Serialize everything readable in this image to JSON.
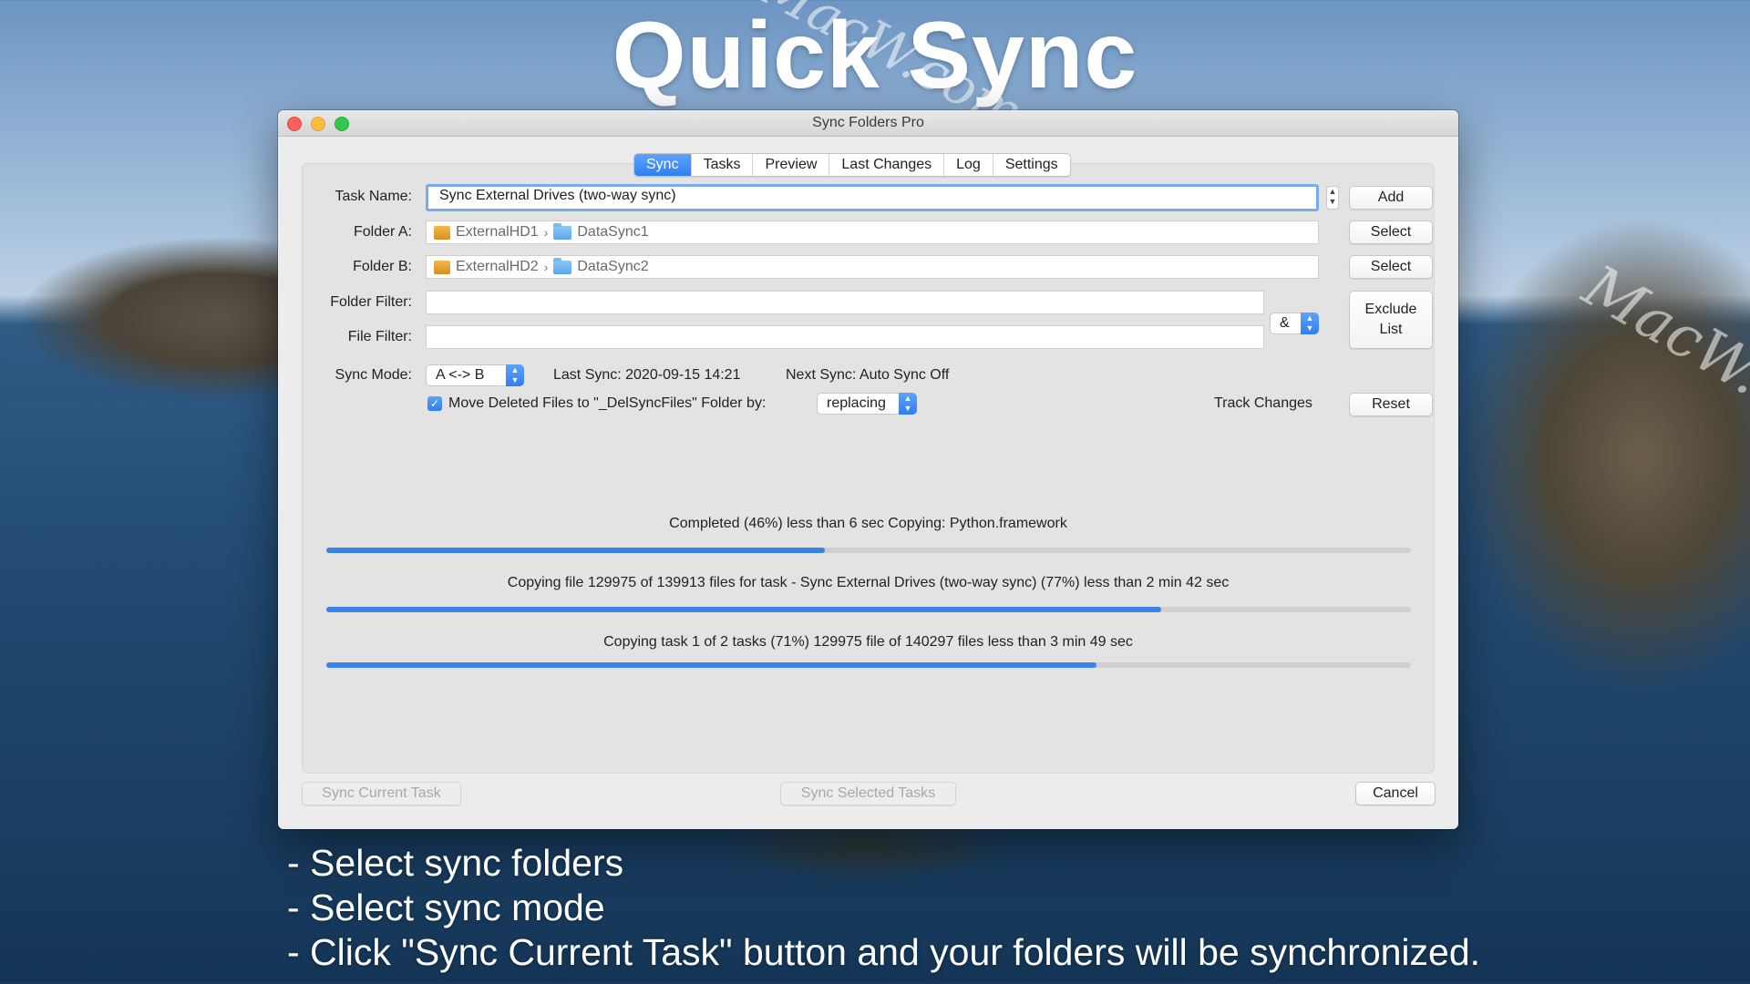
{
  "promo": {
    "title": "Quick Sync",
    "watermark": "MacW.com",
    "captions": [
      "- Select sync folders",
      "- Select sync mode",
      "- Click \"Sync Current Task\" button and your folders will be synchronized."
    ]
  },
  "window": {
    "title": "Sync Folders Pro"
  },
  "tabs": [
    {
      "label": "Sync",
      "active": true
    },
    {
      "label": "Tasks"
    },
    {
      "label": "Preview"
    },
    {
      "label": "Last Changes"
    },
    {
      "label": "Log"
    },
    {
      "label": "Settings"
    }
  ],
  "form": {
    "task_name_label": "Task Name:",
    "task_name_value": "Sync External Drives (two-way sync)",
    "folder_a_label": "Folder A:",
    "folder_a_drive": "ExternalHD1",
    "folder_a_folder": "DataSync1",
    "folder_b_label": "Folder B:",
    "folder_b_drive": "ExternalHD2",
    "folder_b_folder": "DataSync2",
    "folder_filter_label": "Folder Filter:",
    "file_filter_label": "File Filter:",
    "filter_operator": "&",
    "sync_mode_label": "Sync Mode:",
    "sync_mode_value": "A <-> B",
    "last_sync": "Last Sync: 2020-09-15 14:21",
    "next_sync": "Next Sync: Auto Sync Off",
    "move_deleted_label": "Move Deleted Files to \"_DelSyncFiles\" Folder by:",
    "move_deleted_checked": true,
    "move_deleted_mode": "replacing",
    "track_changes_label": "Track Changes"
  },
  "buttons": {
    "add": "Add",
    "select_a": "Select",
    "select_b": "Select",
    "exclude_list_line1": "Exclude",
    "exclude_list_line2": "List",
    "reset": "Reset",
    "sync_current": "Sync Current Task",
    "sync_selected": "Sync Selected Tasks",
    "cancel": "Cancel"
  },
  "progress": [
    {
      "label": "Completed (46%) less than 6 sec Copying: Python.framework",
      "fraction": 0.46
    },
    {
      "label": "Copying file 129975 of 139913 files for task - Sync External Drives (two-way sync) (77%) less than 2 min 42 sec",
      "fraction": 0.77
    },
    {
      "label": "Copying task 1 of 2 tasks (71%) 129975 file of 140297 files less than 3 min 49 sec",
      "fraction": 0.71
    }
  ],
  "colors": {
    "accent": "#2f7ff2",
    "progress_fill": "#3a82e8",
    "close": "#fc605c",
    "minimize": "#fdbc40",
    "maximize": "#34c84a"
  }
}
